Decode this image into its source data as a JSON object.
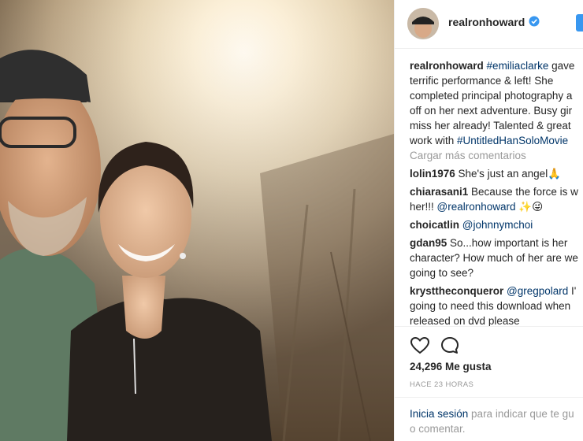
{
  "post": {
    "author": "realronhoward",
    "caption_lines": [
      {
        "user": "realronhoward",
        "tag": "#emiliaclarke",
        "text": " gave"
      },
      {
        "text": "terrific performance & left! She"
      },
      {
        "text": "completed principal photography a"
      },
      {
        "text": "off on her next adventure. Busy gir"
      },
      {
        "text": "miss her already! Talented & great"
      },
      {
        "prefix": "work with ",
        "tag": "#UntitledHanSoloMovie"
      }
    ],
    "load_more": "Cargar más comentarios",
    "comments": [
      {
        "user": "lolin1976",
        "text": " She's just an angel",
        "emoji": "🙏"
      },
      {
        "user": "chiarasani1",
        "text": " Because the force is w",
        "line2_text": "her!!! ",
        "line2_tag": "@realronhoward",
        "line2_emoji": "✨😜"
      },
      {
        "user": "choicatlin",
        "tag": " @johnnymchoi"
      },
      {
        "user": "gdan95",
        "text": " So...how important is her",
        "line2_text": "character? How much of her are we",
        "line3_text": "going to see?"
      },
      {
        "user": "krysttheconqueror",
        "tag": " @gregpolard",
        "text": " I'",
        "line2_text": "going to need this download when",
        "line3_text": "released on dvd please"
      }
    ],
    "likes": "24,296 Me gusta",
    "time": "HACE 23 HORAS",
    "footer": {
      "login": "Inicia sesión",
      "text1": " para indicar que te gu",
      "text2": "o comentar."
    }
  },
  "colors": {
    "link": "#003569",
    "verified": "#3897f0",
    "muted": "#999999"
  },
  "icons": [
    "verified-badge-icon",
    "heart-icon",
    "comment-icon"
  ]
}
